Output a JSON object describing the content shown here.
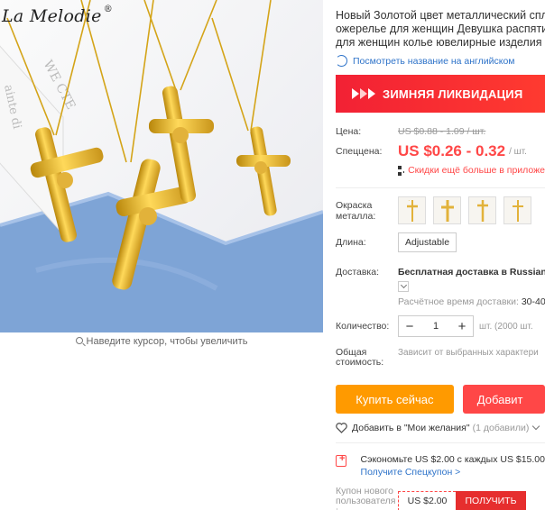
{
  "product_image": {
    "brand": "La Melodie",
    "brand_mark": "®",
    "box_print": [
      "WE CTE",
      "ainte di"
    ],
    "zoom_hint": "Наведите курсор, чтобы увеличить"
  },
  "product": {
    "title_lines": [
      "Новый Золотой цвет металлический спл",
      "ожерелье для женщин Девушка распяти",
      "для женщин колье ювелирные изделия"
    ],
    "translate_link": "Посмотреть название на английском"
  },
  "promo_banner": {
    "text": "ЗИМНЯЯ ЛИКВИДАЦИЯ",
    "color": "#ff3b30"
  },
  "price": {
    "label": "Цена:",
    "original": "US $0.88 - 1.09 / шт.",
    "sale_label": "Спеццена:",
    "sale": "US $0.26 - 0.32",
    "unit": "/ шт.",
    "app_discount": "Скидки ещё больше в приложе",
    "accent_color": "#ff4747"
  },
  "options": {
    "color_label_line1": "Окраска",
    "color_label_line2": "металла:",
    "color_swatch_count": 4,
    "length_label": "Длина:",
    "length_value": "Adjustable"
  },
  "shipping": {
    "label": "Доставка:",
    "method": "Бесплатная доставка в Russian F",
    "time_label": "Расчётное время доставки:",
    "time_value": "30-40"
  },
  "quantity": {
    "label": "Количество:",
    "minus": "−",
    "value": "1",
    "plus": "+",
    "note": "шт. (2000 шт. "
  },
  "total": {
    "label_line1": "Общая",
    "label_line2": "стоимость:",
    "value": "Зависит от выбранных характери"
  },
  "actions": {
    "buy_now": "Купить сейчас",
    "add_to_cart": "Добавит",
    "wishlist": "Добавить в \"Мои желания\"",
    "wishlist_count": "(1 добавили)"
  },
  "savings": {
    "text": "Сэкономьте US $2.00 с каждых US $15.00",
    "link": "Получите Спецкупон >"
  },
  "coupon": {
    "label_line1": "Купон нового",
    "label_line2": "пользователя",
    "label_line3": ":",
    "amount": "US $2.00",
    "get_button": "ПОЛУЧИТЬ"
  }
}
